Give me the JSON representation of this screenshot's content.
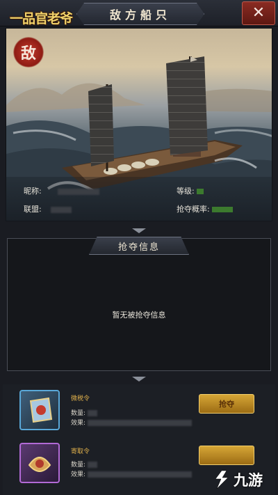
{
  "header": {
    "logo_text": "一品官老爷",
    "title": "敌方船只",
    "close_label": "✕"
  },
  "scene": {
    "enemy_badge": "敌"
  },
  "info": {
    "nickname_label": "昵称:",
    "alliance_label": "联盟:",
    "level_label": "等级:",
    "plunder_rate_label": "抢夺概率:"
  },
  "plunder": {
    "title": "抢夺信息",
    "empty_message": "暂无被抢夺信息"
  },
  "items": [
    {
      "name": "微税令",
      "quantity_label": "数量:",
      "effect_label": "效果:",
      "button_label": "抢夺"
    },
    {
      "name": "寄取令",
      "quantity_label": "数量:",
      "effect_label": "效果:",
      "button_label": ""
    }
  ],
  "watermark": {
    "text": "九游"
  },
  "colors": {
    "gold": "#e2b24c",
    "enemy_red": "#c43a2c",
    "button_gold": "#d6a636"
  }
}
